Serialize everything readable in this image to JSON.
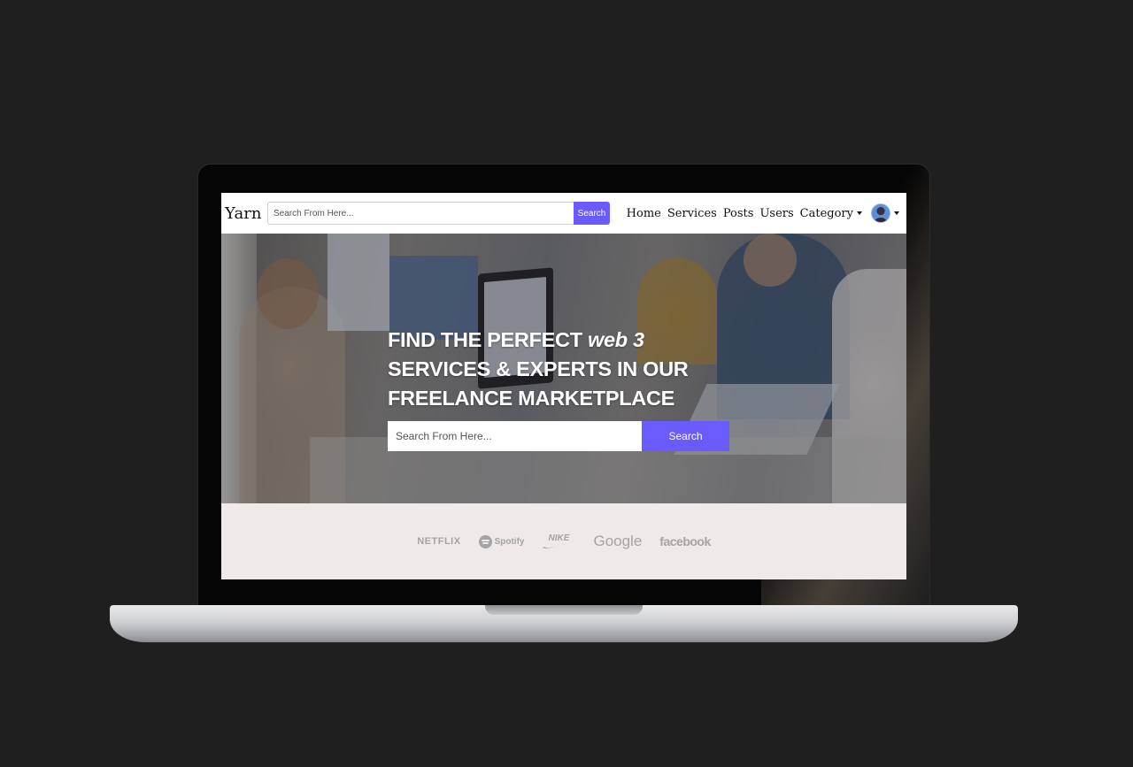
{
  "navbar": {
    "brand": "Yarn",
    "search_placeholder": "Search From Here...",
    "search_button": "Search",
    "links": [
      "Home",
      "Services",
      "Posts",
      "Users",
      "Category"
    ]
  },
  "hero": {
    "title_part1": "FIND THE PERFECT ",
    "title_emphasis": "web 3",
    "title_part2": " SERVICES & EXPERTS IN OUR FREELANCE MARKETPLACE",
    "search_placeholder": "Search From Here...",
    "search_button": "Search"
  },
  "brands": [
    "NETFLIX",
    "Spotify",
    "NIKE",
    "Google",
    "facebook"
  ],
  "colors": {
    "accent": "#6a5bff",
    "brands_background": "#efe9e9",
    "page_background": "#1f1f1f"
  },
  "icons": [
    "category-caret-icon",
    "avatar",
    "profile-caret-icon",
    "spotify-icon",
    "nike-swoosh-icon"
  ]
}
